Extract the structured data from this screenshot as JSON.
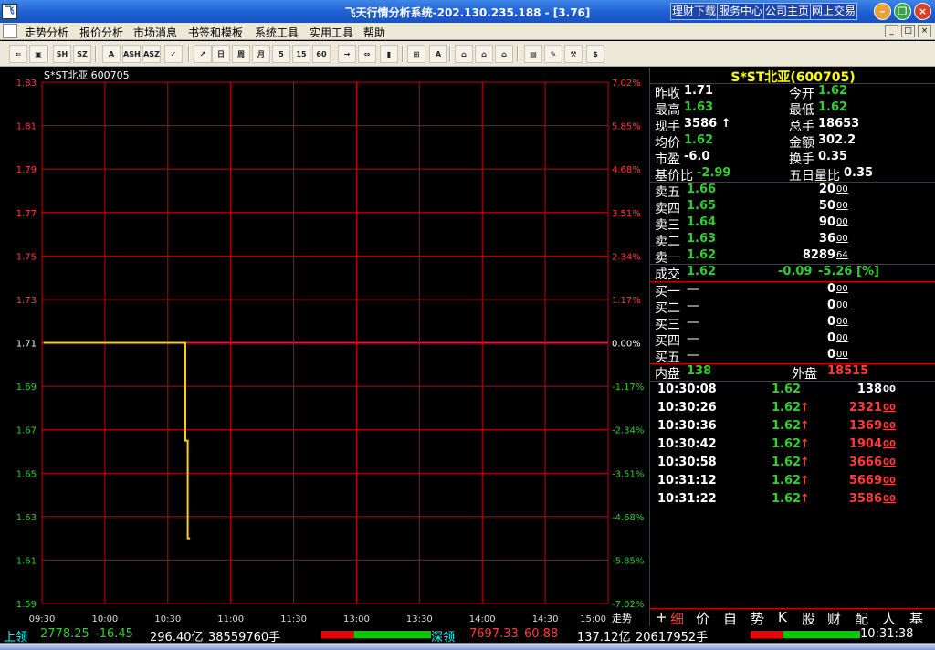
{
  "window": {
    "title": "飞天行情分析系统-202.130.235.188 - [3.76]",
    "icon_label": "飞"
  },
  "title_links": [
    "理财下载",
    "服务中心",
    "公司主页",
    "网上交易"
  ],
  "menu": [
    "走势分析",
    "报价分析",
    "市场消息",
    "书签和模板",
    "系统工具",
    "实用工具",
    "帮助"
  ],
  "mdi_buttons": [
    "_",
    "□",
    "×"
  ],
  "toolbar_icons": [
    {
      "name": "back-icon",
      "glyph": "⇐"
    },
    {
      "name": "window-icon",
      "glyph": "▣"
    },
    {
      "name": "sh-index-icon",
      "glyph": "SH"
    },
    {
      "name": "sz-index-icon",
      "glyph": "SZ"
    },
    {
      "name": "a-shares-icon",
      "glyph": "A"
    },
    {
      "name": "ash-icon",
      "glyph": "ASH"
    },
    {
      "name": "asz-icon",
      "glyph": "ASZ"
    },
    {
      "name": "checklist-icon",
      "glyph": "✓"
    },
    {
      "name": "trend-chart-icon",
      "glyph": "↗"
    },
    {
      "name": "daily-kline-icon",
      "glyph": "日"
    },
    {
      "name": "weekly-kline-icon",
      "glyph": "周"
    },
    {
      "name": "monthly-kline-icon",
      "glyph": "月"
    },
    {
      "name": "5min-kline-icon",
      "glyph": "5"
    },
    {
      "name": "15min-kline-icon",
      "glyph": "15"
    },
    {
      "name": "60min-kline-icon",
      "glyph": "60"
    },
    {
      "name": "arrow-right-icon",
      "glyph": "→"
    },
    {
      "name": "split-view-icon",
      "glyph": "⇔"
    },
    {
      "name": "bar-volume-icon",
      "glyph": "▮"
    },
    {
      "name": "grid-table-icon",
      "glyph": "⊞"
    },
    {
      "name": "formula-a-icon",
      "glyph": "A"
    },
    {
      "name": "home-icon",
      "glyph": "⌂"
    },
    {
      "name": "home-2-icon",
      "glyph": "⌂"
    },
    {
      "name": "home-3-icon",
      "glyph": "⌂"
    },
    {
      "name": "book-icon",
      "glyph": "▤"
    },
    {
      "name": "edit-document-icon",
      "glyph": "✎"
    },
    {
      "name": "tools-icon",
      "glyph": "⚒"
    },
    {
      "name": "finance-icon",
      "glyph": "$"
    }
  ],
  "chart": {
    "header": "S*ST北亚 600705",
    "time_end_label": "走势"
  },
  "chart_data": {
    "type": "line",
    "x_labels": [
      "09:30",
      "10:00",
      "10:30",
      "11:00",
      "11:30",
      "13:00",
      "13:30",
      "14:00",
      "14:30",
      "15:00"
    ],
    "y_ticks_left": [
      "1.83",
      "1.81",
      "1.79",
      "1.77",
      "1.75",
      "1.73",
      "1.71",
      "1.69",
      "1.67",
      "1.65",
      "1.63",
      "1.61",
      "1.59"
    ],
    "y_ticks_right": [
      "7.02%",
      "5.85%",
      "4.68%",
      "3.51%",
      "2.34%",
      "1.17%",
      "0.00%",
      "-1.17%",
      "-2.34%",
      "-3.51%",
      "-4.68%",
      "-5.85%",
      "-7.02%"
    ],
    "ylim": [
      1.59,
      1.83
    ],
    "prev_close": 1.71,
    "price_series": {
      "minutes": [
        0,
        60,
        60,
        61,
        61,
        62
      ],
      "values": [
        1.71,
        1.71,
        1.665,
        1.665,
        1.62,
        1.62
      ]
    }
  },
  "quote": {
    "title": "S*ST北亚(600705)",
    "fields": [
      {
        "label": "昨收",
        "value": "1.71",
        "color": "w"
      },
      {
        "label": "今开",
        "value": "1.62",
        "color": "g"
      },
      {
        "label": "最高",
        "value": "1.63",
        "color": "g"
      },
      {
        "label": "最低",
        "value": "1.62",
        "color": "g"
      },
      {
        "label": "现手",
        "value": "3586 ↑",
        "color": "w"
      },
      {
        "label": "总手",
        "value": "18653",
        "color": "w"
      },
      {
        "label": "均价",
        "value": "1.62",
        "color": "g"
      },
      {
        "label": "金额",
        "value": "302.2",
        "color": "w"
      },
      {
        "label": "市盈",
        "value": "-6.0",
        "color": "w"
      },
      {
        "label": "换手",
        "value": "0.35",
        "color": "w"
      },
      {
        "label": "基价比",
        "value": "-2.99",
        "color": "g"
      },
      {
        "label": "五日量比",
        "value": "0.35",
        "color": "w"
      }
    ],
    "asks": [
      {
        "label": "卖五",
        "price": "1.66",
        "vol": "20",
        "vol_small": "00"
      },
      {
        "label": "卖四",
        "price": "1.65",
        "vol": "50",
        "vol_small": "00"
      },
      {
        "label": "卖三",
        "price": "1.64",
        "vol": "90",
        "vol_small": "00"
      },
      {
        "label": "卖二",
        "price": "1.63",
        "vol": "36",
        "vol_small": "00"
      },
      {
        "label": "卖一",
        "price": "1.62",
        "vol": "8289",
        "vol_small": "64"
      }
    ],
    "deal": {
      "label": "成交",
      "price": "1.62",
      "change": "-0.09",
      "pct": "-5.26 [%]"
    },
    "bids": [
      {
        "label": "买一",
        "price": "—",
        "vol": "0",
        "vol_small": "00"
      },
      {
        "label": "买二",
        "price": "—",
        "vol": "0",
        "vol_small": "00"
      },
      {
        "label": "买三",
        "price": "—",
        "vol": "0",
        "vol_small": "00"
      },
      {
        "label": "买四",
        "price": "—",
        "vol": "0",
        "vol_small": "00"
      },
      {
        "label": "买五",
        "price": "—",
        "vol": "0",
        "vol_small": "00"
      }
    ],
    "inner": {
      "label": "内盘",
      "value": "138"
    },
    "outer": {
      "label": "外盘",
      "value": "18515"
    },
    "ticks": [
      {
        "time": "10:30:08",
        "price": "1.62",
        "arrow": "",
        "vol": "138",
        "vol_small": "00",
        "color": "w"
      },
      {
        "time": "10:30:26",
        "price": "1.62",
        "arrow": "↑",
        "vol": "2321",
        "vol_small": "00",
        "color": "r"
      },
      {
        "time": "10:30:36",
        "price": "1.62",
        "arrow": "↑",
        "vol": "1369",
        "vol_small": "00",
        "color": "r"
      },
      {
        "time": "10:30:42",
        "price": "1.62",
        "arrow": "↑",
        "vol": "1904",
        "vol_small": "00",
        "color": "r"
      },
      {
        "time": "10:30:58",
        "price": "1.62",
        "arrow": "↑",
        "vol": "3666",
        "vol_small": "00",
        "color": "r"
      },
      {
        "time": "10:31:12",
        "price": "1.62",
        "arrow": "↑",
        "vol": "5669",
        "vol_small": "00",
        "color": "r"
      },
      {
        "time": "10:31:22",
        "price": "1.62",
        "arrow": "↑",
        "vol": "3586",
        "vol_small": "00",
        "color": "r"
      }
    ],
    "tabs": [
      "+",
      "细",
      "价",
      "自",
      "势",
      "K",
      "股",
      "财",
      "配",
      "人",
      "基"
    ]
  },
  "status": {
    "sh_label": "上领",
    "sh_index": "2778.25",
    "sh_change": "-16.45",
    "sh_amount": "296.40亿",
    "sh_volume": "38559760手",
    "sz_label": "深领",
    "sz_index": "7697.33",
    "sz_change": "60.88",
    "sz_amount": "137.12亿",
    "sz_volume": "20617952手",
    "clock": "10:31:38",
    "sh_up_ratio": 0.3,
    "sz_up_ratio": 0.3
  }
}
